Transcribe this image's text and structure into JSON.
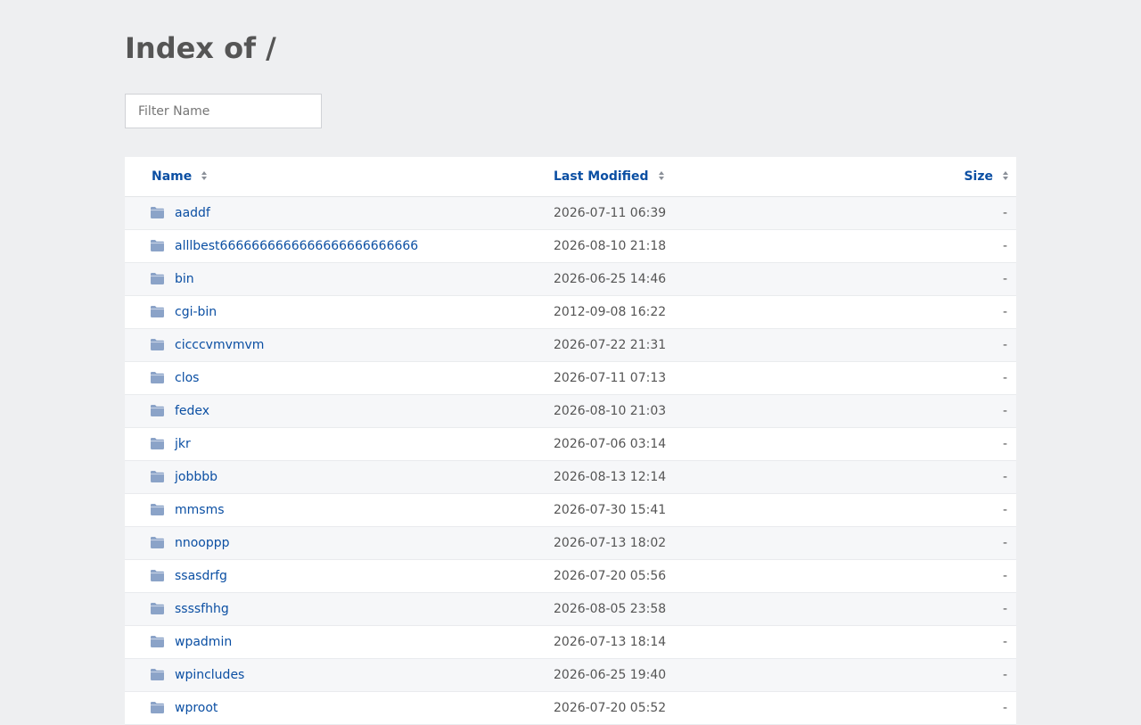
{
  "page_title": "Index of /",
  "filter": {
    "placeholder": "Filter Name",
    "value": ""
  },
  "columns": {
    "name": "Name",
    "last_modified": "Last Modified",
    "size": "Size"
  },
  "icons": {
    "sort": "sort-arrows-icon",
    "folder": "folder-icon"
  },
  "colors": {
    "link": "#0b4fa3",
    "folder": "#8ba3c8",
    "background": "#eeeff1"
  },
  "entries": [
    {
      "name": "aaddf",
      "modified": "2026-07-11 06:39",
      "size": "-"
    },
    {
      "name": "alllbest6666666666666666666666666",
      "modified": "2026-08-10 21:18",
      "size": "-"
    },
    {
      "name": "bin",
      "modified": "2026-06-25 14:46",
      "size": "-"
    },
    {
      "name": "cgi-bin",
      "modified": "2012-09-08 16:22",
      "size": "-"
    },
    {
      "name": "cicccvmvmvm",
      "modified": "2026-07-22 21:31",
      "size": "-"
    },
    {
      "name": "clos",
      "modified": "2026-07-11 07:13",
      "size": "-"
    },
    {
      "name": "fedex",
      "modified": "2026-08-10 21:03",
      "size": "-"
    },
    {
      "name": "jkr",
      "modified": "2026-07-06 03:14",
      "size": "-"
    },
    {
      "name": "jobbbb",
      "modified": "2026-08-13 12:14",
      "size": "-"
    },
    {
      "name": "mmsms",
      "modified": "2026-07-30 15:41",
      "size": "-"
    },
    {
      "name": "nnooppp",
      "modified": "2026-07-13 18:02",
      "size": "-"
    },
    {
      "name": "ssasdrfg",
      "modified": "2026-07-20 05:56",
      "size": "-"
    },
    {
      "name": "ssssfhhg",
      "modified": "2026-08-05 23:58",
      "size": "-"
    },
    {
      "name": "wpadmin",
      "modified": "2026-07-13 18:14",
      "size": "-"
    },
    {
      "name": "wpincludes",
      "modified": "2026-06-25 19:40",
      "size": "-"
    },
    {
      "name": "wproot",
      "modified": "2026-07-20 05:52",
      "size": "-"
    }
  ]
}
